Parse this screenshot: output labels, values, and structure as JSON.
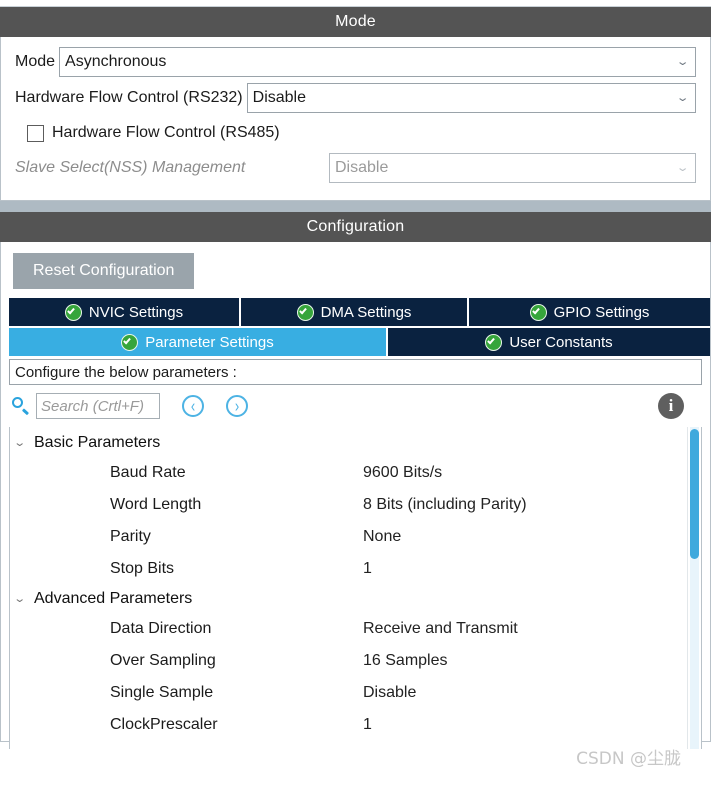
{
  "mode_panel": {
    "title": "Mode",
    "rows": [
      {
        "label": "Mode",
        "value": "Asynchronous",
        "disabled": false
      },
      {
        "label": "Hardware Flow Control (RS232)",
        "value": "Disable",
        "disabled": false
      }
    ],
    "checkbox": {
      "label": "Hardware Flow Control (RS485)",
      "checked": false
    },
    "disabled_row": {
      "label": "Slave Select(NSS) Management",
      "value": "Disable",
      "disabled": true
    },
    "chevron_glyph": "⌄"
  },
  "configuration_panel": {
    "title": "Configuration",
    "reset_button": "Reset Configuration",
    "tabs_row1": [
      {
        "label": "NVIC Settings",
        "icon": "green-check-icon",
        "active": false
      },
      {
        "label": "DMA Settings",
        "icon": "green-check-icon",
        "active": false
      },
      {
        "label": "GPIO Settings",
        "icon": "green-check-icon",
        "active": false
      }
    ],
    "tabs_row2": [
      {
        "label": "Parameter Settings",
        "icon": "green-check-icon",
        "active": true
      },
      {
        "label": "User Constants",
        "icon": "green-check-icon",
        "active": false
      }
    ],
    "instruction": "Configure the below parameters :",
    "search": {
      "placeholder": "Search (Crtl+F)",
      "value": "",
      "prev_glyph": "‹",
      "next_glyph": "›",
      "info_glyph": "i"
    },
    "tree": {
      "twisty_glyph": "⌄",
      "groups": [
        {
          "name": "Basic Parameters",
          "expanded": true,
          "params": [
            {
              "name": "Baud Rate",
              "value": "9600 Bits/s"
            },
            {
              "name": "Word Length",
              "value": "8 Bits (including Parity)"
            },
            {
              "name": "Parity",
              "value": "None"
            },
            {
              "name": "Stop Bits",
              "value": "1"
            }
          ]
        },
        {
          "name": "Advanced Parameters",
          "expanded": true,
          "params": [
            {
              "name": "Data Direction",
              "value": "Receive and Transmit"
            },
            {
              "name": "Over Sampling",
              "value": "16 Samples"
            },
            {
              "name": "Single Sample",
              "value": "Disable"
            },
            {
              "name": "ClockPrescaler",
              "value": "1"
            }
          ]
        }
      ]
    }
  },
  "watermark": "CSDN @尘胧",
  "colors": {
    "panel_header_bg": "#545454",
    "tab_inactive_bg": "#0a2240",
    "tab_active_bg": "#38aee2",
    "accent_blue": "#2aa3dd",
    "button_gray": "#9aa4ab",
    "check_green": "#36a53b",
    "band_gray": "#aebac3"
  }
}
